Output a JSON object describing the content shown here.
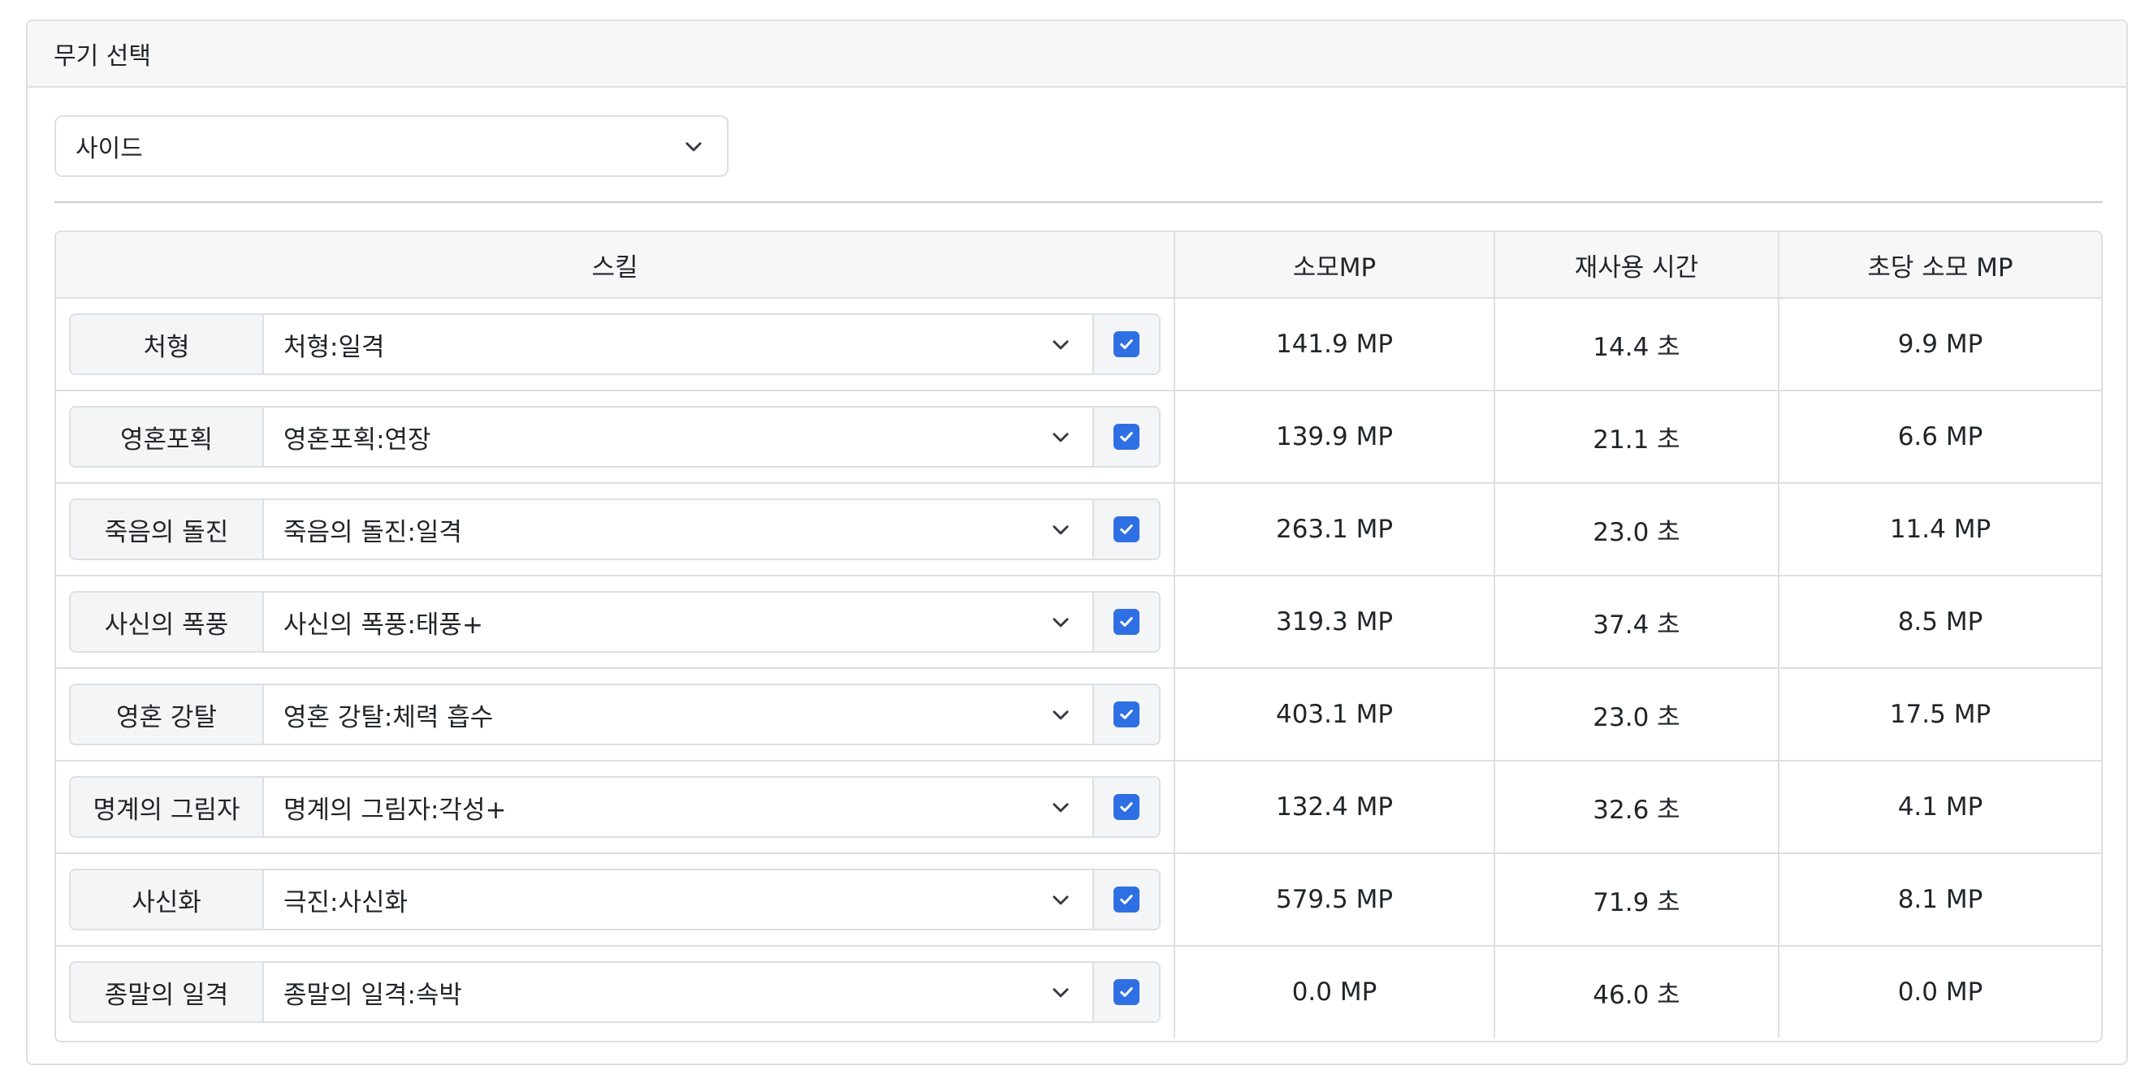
{
  "header": {
    "title": "무기 선택"
  },
  "weapon_select": {
    "value": "사이드"
  },
  "table": {
    "headers": {
      "skill": "스킬",
      "mp_cost": "소모MP",
      "cooldown": "재사용 시간",
      "mp_per_sec": "초당 소모 MP"
    },
    "rows": [
      {
        "skill": "처형",
        "variant": "처형:일격",
        "checked": true,
        "mp_cost": "141.9 MP",
        "cooldown": "14.4 초",
        "mp_per_sec": "9.9 MP"
      },
      {
        "skill": "영혼포획",
        "variant": "영혼포획:연장",
        "checked": true,
        "mp_cost": "139.9 MP",
        "cooldown": "21.1 초",
        "mp_per_sec": "6.6 MP"
      },
      {
        "skill": "죽음의 돌진",
        "variant": "죽음의 돌진:일격",
        "checked": true,
        "mp_cost": "263.1 MP",
        "cooldown": "23.0 초",
        "mp_per_sec": "11.4 MP"
      },
      {
        "skill": "사신의 폭풍",
        "variant": "사신의 폭풍:태풍+",
        "checked": true,
        "mp_cost": "319.3 MP",
        "cooldown": "37.4 초",
        "mp_per_sec": "8.5 MP"
      },
      {
        "skill": "영혼 강탈",
        "variant": "영혼 강탈:체력 흡수",
        "checked": true,
        "mp_cost": "403.1 MP",
        "cooldown": "23.0 초",
        "mp_per_sec": "17.5 MP"
      },
      {
        "skill": "명계의 그림자",
        "variant": "명계의 그림자:각성+",
        "checked": true,
        "mp_cost": "132.4 MP",
        "cooldown": "32.6 초",
        "mp_per_sec": "4.1 MP"
      },
      {
        "skill": "사신화",
        "variant": "극진:사신화",
        "checked": true,
        "mp_cost": "579.5 MP",
        "cooldown": "71.9 초",
        "mp_per_sec": "8.1 MP"
      },
      {
        "skill": "종말의 일격",
        "variant": "종말의 일격:속박",
        "checked": true,
        "mp_cost": "0.0 MP",
        "cooldown": "46.0 초",
        "mp_per_sec": "0.0 MP"
      }
    ]
  },
  "colors": {
    "accent": "#2f6fe4",
    "border": "#dcdfe3",
    "header_bg": "#f7f7f8"
  }
}
